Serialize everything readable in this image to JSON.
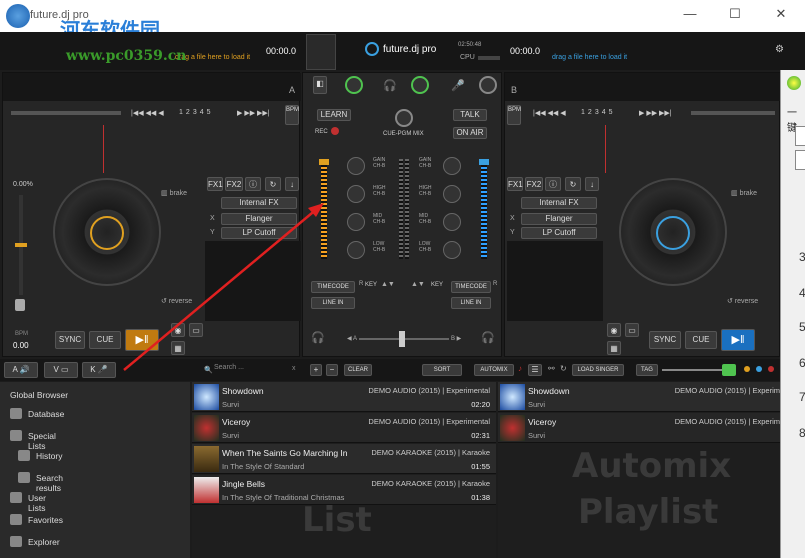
{
  "window": {
    "title": "future.dj pro",
    "watermark": "河东软件园",
    "watermark_url": "www.pc0359.cn"
  },
  "deckA": {
    "letter": "A",
    "time": "00:00.0",
    "drop_text": "drag a file here to load it",
    "pitch": "0.00%",
    "bpm_label": "BPM",
    "bpm": "0.00",
    "brake": "brake",
    "reverse": "reverse",
    "loop_nums": [
      "1",
      "2",
      "3",
      "4",
      "5"
    ],
    "fx1": "FX1",
    "fx2": "FX2",
    "fx_select": "Internal FX",
    "fx_x_label": "X",
    "fx_x": "Flanger",
    "fx_y_label": "Y",
    "fx_y": "LP Cutoff",
    "sync": "SYNC",
    "cue": "CUE",
    "bpm_btn": "BPM"
  },
  "deckB": {
    "letter": "B",
    "time": "00:00.0",
    "drop_text": "drag a file here to load it",
    "fx1": "FX1",
    "fx2": "FX2",
    "fx_select": "Internal FX",
    "fx_x_label": "X",
    "fx_x": "Flanger",
    "fx_y_label": "Y",
    "fx_y": "LP Cutoff",
    "sync": "SYNC",
    "cue": "CUE",
    "brake": "brake",
    "reverse": "reverse",
    "loop_nums": [
      "1",
      "2",
      "3",
      "4",
      "5"
    ],
    "bpm_btn": "BPM"
  },
  "mixer": {
    "brand": "future.dj pro",
    "clock": "02:50:48",
    "cpu_label": "CPU",
    "learn": "LEARN",
    "rec": "REC",
    "cue_pgm": "CUE-PGM MIX",
    "talk": "TALK",
    "on_air": "ON AIR",
    "eq": [
      "GAIN",
      "HIGH",
      "MID",
      "LOW"
    ],
    "eq_sub": [
      "CH-B",
      "CH-B",
      "CH-B",
      "CH-B"
    ],
    "timecode": "TIMECODE",
    "line_in": "LINE IN",
    "key": "KEY",
    "r": "R",
    "a": "A",
    "b": "B"
  },
  "toolbar": {
    "a": "A",
    "v": "V",
    "k": "K",
    "search_placeholder": "Search ...",
    "clear": "CLEAR",
    "sort": "SORT",
    "automix": "AUTOMIX",
    "load_singer": "LOAD SINGER",
    "tag": "TAG"
  },
  "sidebar": {
    "header": "Global Browser",
    "items": [
      {
        "label": "Database",
        "icon": "database-icon"
      },
      {
        "label": "Special Lists",
        "icon": "star-icon"
      },
      {
        "label": "History",
        "icon": "history-icon"
      },
      {
        "label": "Search results",
        "icon": "search-icon"
      },
      {
        "label": "User Lists",
        "icon": "user-lists-icon"
      },
      {
        "label": "Favorites",
        "icon": "heart-icon"
      },
      {
        "label": "Explorer",
        "icon": "folder-icon"
      }
    ]
  },
  "list": {
    "watermark": "List",
    "rows": [
      {
        "title": "Showdown",
        "artist": "Survi",
        "album": "DEMO AUDIO (2015) | Experimental",
        "time": "02:20"
      },
      {
        "title": "Viceroy",
        "artist": "Survi",
        "album": "DEMO AUDIO (2015) | Experimental",
        "time": "02:31"
      },
      {
        "title": "When The Saints Go Marching In",
        "artist": "In The Style Of Standard",
        "album": "DEMO KARAOKE (2015) | Karaoke",
        "time": "01:55"
      },
      {
        "title": "Jingle Bells",
        "artist": "In The Style Of Traditional Christmas",
        "album": "DEMO KARAOKE (2015) | Karaoke",
        "time": "01:38"
      }
    ]
  },
  "automix": {
    "watermark1": "Automix",
    "watermark2": "Playlist",
    "rows": [
      {
        "title": "Showdown",
        "artist": "Survi",
        "album": "DEMO AUDIO (2015) | Experim"
      },
      {
        "title": "Viceroy",
        "artist": "Survi",
        "album": "DEMO AUDIO (2015) | Experim"
      }
    ]
  },
  "right_window": {
    "text": "一键",
    "nums": [
      "3",
      "4",
      "5",
      "6",
      "7",
      "8"
    ]
  },
  "colors": {
    "deckA": "#e0a020",
    "deckB": "#3aa0e0",
    "arrow": "#e02020"
  }
}
